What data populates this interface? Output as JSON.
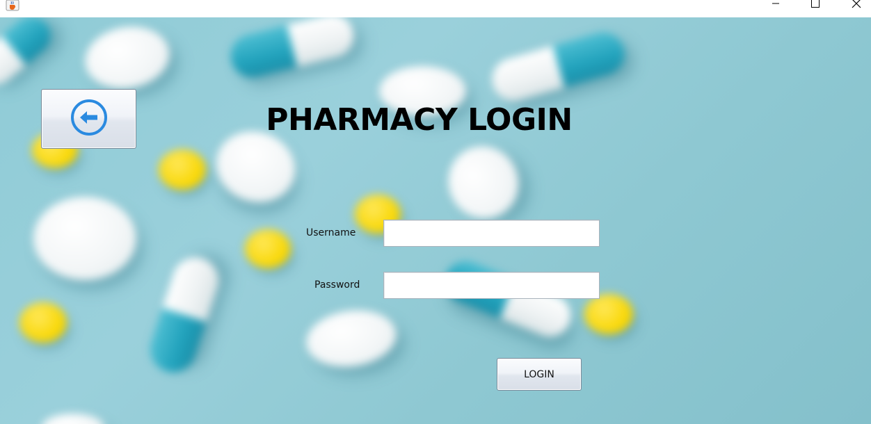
{
  "window": {
    "app_icon": "java-cup-icon",
    "controls": {
      "minimize_icon": "minimize-icon",
      "maximize_icon": "maximize-icon",
      "close_icon": "close-icon"
    }
  },
  "header": {
    "title": "PHARMACY LOGIN",
    "back_icon": "arrow-left-circle-icon"
  },
  "form": {
    "username_label": "Username",
    "username_value": "",
    "password_label": "Password",
    "password_value": "",
    "login_label": "LOGIN"
  },
  "colors": {
    "background": "#8fcbd6",
    "back_icon": "#2a8ae0",
    "button_face": "#e6ebf2"
  }
}
